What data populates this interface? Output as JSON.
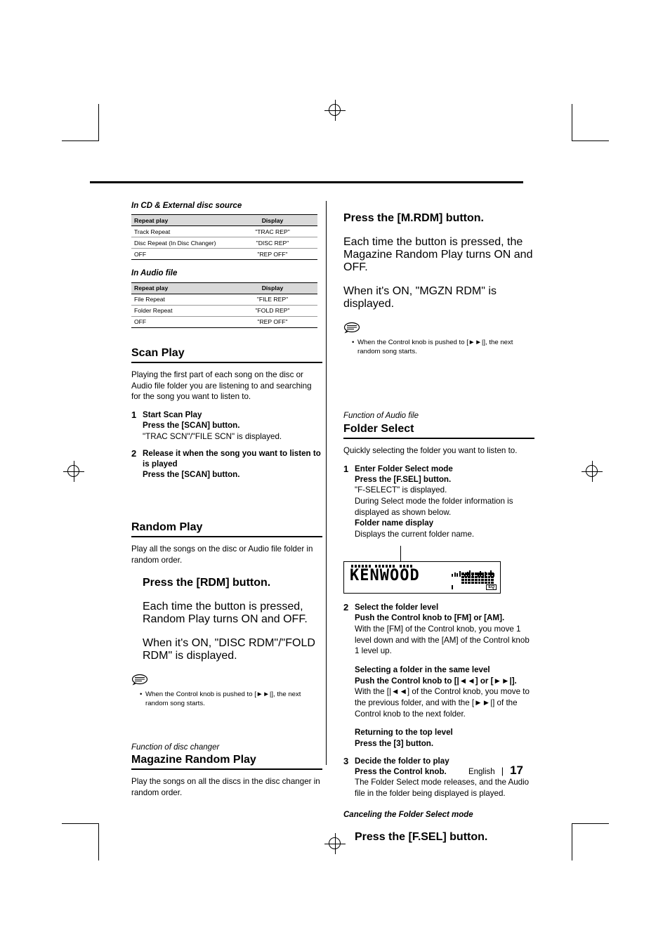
{
  "page": {
    "language": "English",
    "number": "17"
  },
  "left_column": {
    "cd_section_title": "In CD & External disc source",
    "cd_table": {
      "headers": [
        "Repeat play",
        "Display"
      ],
      "rows": [
        [
          "Track Repeat",
          "\"TRAC REP\""
        ],
        [
          "Disc Repeat (In Disc Changer)",
          "\"DISC REP\""
        ],
        [
          "OFF",
          "\"REP OFF\""
        ]
      ]
    },
    "audio_section_title": "In Audio file",
    "audio_table": {
      "headers": [
        "Repeat play",
        "Display"
      ],
      "rows": [
        [
          "File Repeat",
          "\"FILE REP\""
        ],
        [
          "Folder Repeat",
          "\"FOLD REP\""
        ],
        [
          "OFF",
          "\"REP OFF\""
        ]
      ]
    },
    "scan_play": {
      "heading": "Scan Play",
      "intro": "Playing the first part of each song on the disc or Audio file folder you are listening to and searching for the song you want to listen to.",
      "steps": [
        {
          "num": "1",
          "title": "Start Scan Play",
          "lines": [
            {
              "text": "Press the [SCAN] button.",
              "bold": true
            },
            {
              "text": "\"TRAC SCN\"/\"FILE SCN\" is displayed.",
              "bold": false
            }
          ]
        },
        {
          "num": "2",
          "title": "Release it when the song you want to listen to is played",
          "lines": [
            {
              "text": "Press the [SCAN] button.",
              "bold": true
            }
          ]
        }
      ]
    },
    "random_play": {
      "heading": "Random Play",
      "intro": "Play all the songs on the disc or Audio file folder in random order.",
      "action_title": "Press the [RDM] button.",
      "action_lines": [
        "Each time the button is pressed, Random Play turns ON and OFF.",
        "When it's ON, \"DISC RDM\"/\"FOLD RDM\" is displayed."
      ],
      "note": "When the Control knob is pushed to [►►|], the next random song starts."
    },
    "magazine": {
      "function_label": "Function of disc changer",
      "heading": "Magazine Random Play",
      "intro": "Play the songs on all the discs in the disc changer in random order."
    }
  },
  "right_column": {
    "mrdm": {
      "action_title": "Press the [M.RDM] button.",
      "lines": [
        "Each time the button is pressed, the Magazine Random Play turns ON and OFF.",
        "When it's ON, \"MGZN RDM\" is displayed."
      ],
      "note": "When the Control knob is pushed to [►►|], the next random song starts."
    },
    "folder_select": {
      "function_label": "Function of Audio file",
      "heading": "Folder Select",
      "intro": "Quickly selecting the folder you want to listen to.",
      "step1": {
        "num": "1",
        "title": "Enter Folder Select mode",
        "lines": [
          {
            "text": "Press the [F.SEL] button.",
            "bold": true
          },
          {
            "text": "\"F-SELECT\" is displayed.",
            "bold": false
          },
          {
            "text": "During Select mode the folder information is displayed as shown below.",
            "bold": false
          },
          {
            "text": "Folder name display",
            "bold": true
          },
          {
            "text": "Displays the current folder name.",
            "bold": false
          }
        ]
      },
      "display_graphic": {
        "text": "KENWOOD",
        "eq_label": "EQ"
      },
      "step2": {
        "num": "2",
        "title": "Select the folder level",
        "lines": [
          {
            "text": "Push the Control knob to [FM] or [AM].",
            "bold": true
          },
          {
            "text": "With the [FM] of the Control knob, you move 1 level down and with the [AM] of the Control knob 1 level up.",
            "bold": false
          }
        ],
        "sub1": {
          "title": "Selecting a folder in the same level",
          "lines": [
            {
              "text": "Push the Control knob to [|◄◄] or [►►|].",
              "bold": true
            },
            {
              "text": "With the [|◄◄] of the Control knob, you move to the previous folder, and with the [►►|] of the Control knob to the next folder.",
              "bold": false
            }
          ]
        },
        "sub2": {
          "title": "Returning to the top level",
          "lines": [
            {
              "text": "Press the [3] button.",
              "bold": true
            }
          ]
        }
      },
      "step3": {
        "num": "3",
        "title": "Decide the folder to play",
        "lines": [
          {
            "text": "Press the Control knob.",
            "bold": true
          },
          {
            "text": "The Folder Select mode releases, and the Audio file in the folder being displayed is played.",
            "bold": false
          }
        ]
      },
      "cancel": {
        "title": "Canceling the Folder Select mode",
        "line": "Press the [F.SEL] button."
      }
    }
  }
}
